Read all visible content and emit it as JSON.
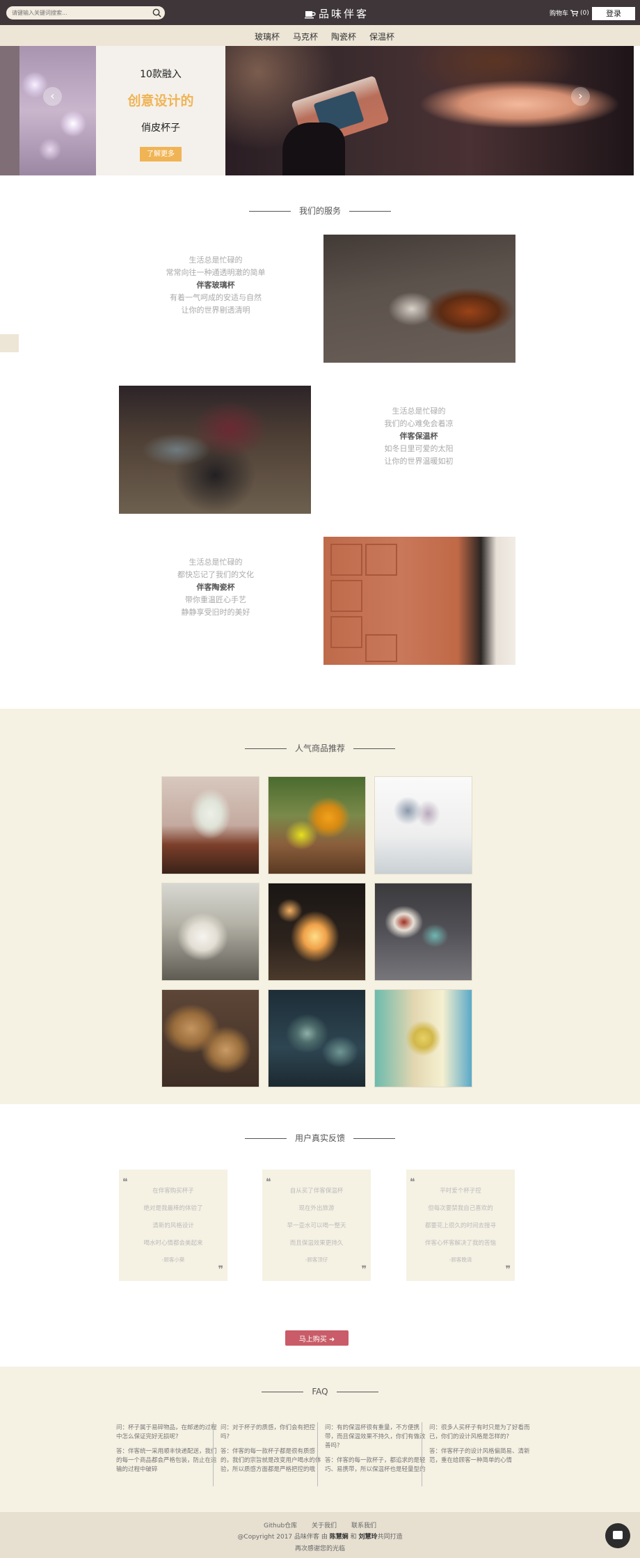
{
  "header": {
    "search_placeholder": "请键输入关键词搜索...",
    "brand": "品味伴客",
    "cart_label": "购物车",
    "cart_count": "(0)",
    "login": "登录"
  },
  "nav": [
    "玻璃杯",
    "马克杯",
    "陶瓷杯",
    "保温杯"
  ],
  "banner": {
    "line1": "10款融入",
    "line2": "创意设计的",
    "line3": "俏皮杯子",
    "button": "了解更多",
    "prev": "‹",
    "next": "›"
  },
  "services": {
    "title": "我们的服务",
    "items": [
      {
        "lines": [
          "生活总是忙碌的",
          "常常向往一种通透明澈的简单"
        ],
        "highlight": "伴客玻璃杯",
        "after": [
          "有着一气呵成的安适与自然",
          "让你的世界剔透清明"
        ]
      },
      {
        "lines": [
          "生活总是忙碌的",
          "我们的心难免会着凉"
        ],
        "highlight": "伴客保温杯",
        "after": [
          "如冬日里可爱的太阳",
          "让你的世界温暖如初"
        ]
      },
      {
        "lines": [
          "生活总是忙碌的",
          "都快忘记了我们的文化"
        ],
        "highlight": "伴客陶瓷杯",
        "after": [
          "带你重温匠心手艺",
          "静静享受旧时的美好"
        ]
      }
    ]
  },
  "popular": {
    "title": "人气商品推荐"
  },
  "feedback": {
    "title": "用户真实反馈",
    "cards": [
      {
        "lines": [
          "在伴客购买杯子",
          "绝对是我最棒的体验了",
          "清新的风格设计",
          "喝水时心情都会美起来"
        ],
        "author": "-顾客小葵"
      },
      {
        "lines": [
          "自从买了伴客保温杯",
          "现在外出旅游",
          "早一壶水可以喝一整天",
          "而且保温效果更持久"
        ],
        "author": "-顾客顶仔"
      },
      {
        "lines": [
          "平时爱个杯子控",
          "但每次要禁我自己喜欢的",
          "都要花上很久的时间去搜寻",
          "伴客心怀客解决了我的苦恼"
        ],
        "author": "-顾客晚清"
      }
    ]
  },
  "buy_button": "马上购买 ➜",
  "faq": {
    "title": "FAQ",
    "items": [
      {
        "q": "问：杯子属于易碎物品，在邮递的过程中怎么保证完好无损呢?",
        "a": "答：伴客统一采用顺丰快递配送，我们的每一个商品都会严格包装，防止在运输的过程中破碎"
      },
      {
        "q": "问：对于杯子的质感，你们会有把控吗?",
        "a": "答：伴客的每一款杯子都是很有质感的，我们的宗旨就是改变用户喝水的体验，所以质感方面都是严格把控的哦"
      },
      {
        "q": "问：有的保温杯很有重量，不方便携带，而且保温效果不持久，你们有做改善吗?",
        "a": "答：伴客的每一款杯子，都追求的是轻巧、易携带，所以保温杯也是轻量型的"
      },
      {
        "q": "问：很多人买杯子有时只是为了好看而已，你们的设计风格是怎样的?",
        "a": "答：伴客杯子的设计风格偏简易、清新范，重在给顾客一种简单的心情"
      }
    ]
  },
  "footer": {
    "links": [
      "Github仓库",
      "关于我们",
      "联系我们"
    ],
    "copy_prefix": "@Copyright 2017 品味伴客 由",
    "author1": "陈慧娴",
    "copy_mid": "和",
    "author2": "刘慧玲",
    "copy_suffix": "共同打造",
    "thanks": "再次感谢您的光临"
  },
  "icons": [
    "search-icon",
    "cup-logo-icon",
    "cart-icon",
    "quote-open-icon",
    "quote-close-icon",
    "chat-icon"
  ]
}
